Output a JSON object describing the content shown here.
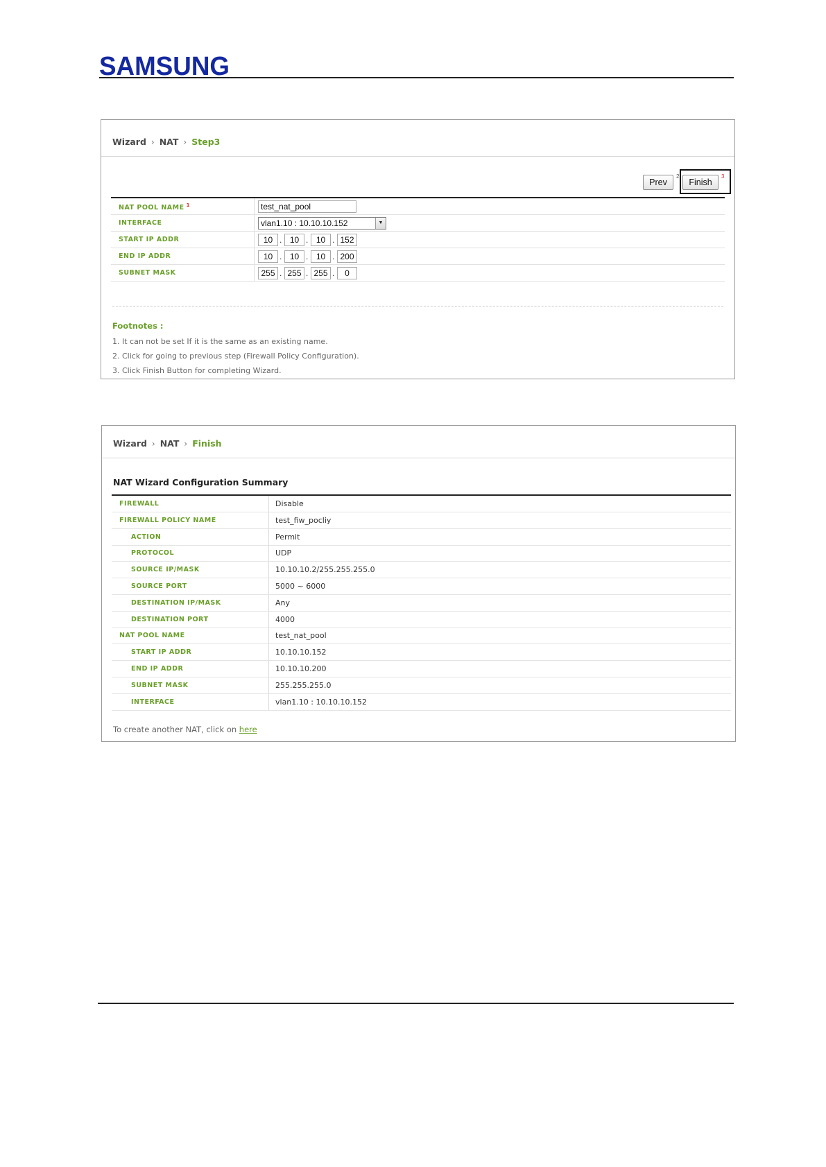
{
  "brand": {
    "logo_text": "SAMSUNG",
    "color": "#1428a0"
  },
  "step3": {
    "breadcrumb": {
      "root": "Wizard",
      "section": "NAT",
      "current": "Step3"
    },
    "buttons": {
      "prev": "Prev",
      "finish": "Finish",
      "prev_note": "2",
      "finish_note": "3"
    },
    "rows": [
      {
        "label": "NAT POOL NAME",
        "note": "1",
        "value": "test_nat_pool"
      },
      {
        "label": "INTERFACE",
        "value": "vlan1.10 : 10.10.10.152"
      },
      {
        "label": "START IP ADDR",
        "octets": [
          "10",
          "10",
          "10",
          "152"
        ]
      },
      {
        "label": "END IP ADDR",
        "octets": [
          "10",
          "10",
          "10",
          "200"
        ]
      },
      {
        "label": "SUBNET MASK",
        "octets": [
          "255",
          "255",
          "255",
          "0"
        ]
      }
    ],
    "footnotes": {
      "title": "Footnotes :",
      "lines": [
        "1. It can not be set If it is the same as an existing name.",
        "2. Click for going to previous step (Firewall Policy Configuration).",
        "3. Click Finish Button for completing Wizard."
      ]
    }
  },
  "finish": {
    "breadcrumb": {
      "root": "Wizard",
      "section": "NAT",
      "current": "Finish"
    },
    "title": "NAT Wizard Configuration Summary",
    "rows": [
      {
        "label": "FIREWALL",
        "value": "Disable",
        "indent": false
      },
      {
        "label": "FIREWALL POLICY NAME",
        "value": "test_fiw_pocliy",
        "indent": false
      },
      {
        "label": "ACTION",
        "value": "Permit",
        "indent": true
      },
      {
        "label": "PROTOCOL",
        "value": "UDP",
        "indent": true
      },
      {
        "label": "SOURCE IP/MASK",
        "value": "10.10.10.2/255.255.255.0",
        "indent": true
      },
      {
        "label": "SOURCE PORT",
        "value": "5000 ~ 6000",
        "indent": true
      },
      {
        "label": "DESTINATION IP/MASK",
        "value": "Any",
        "indent": true
      },
      {
        "label": "DESTINATION PORT",
        "value": "4000",
        "indent": true
      },
      {
        "label": "NAT POOL NAME",
        "value": "test_nat_pool",
        "indent": false
      },
      {
        "label": "START IP ADDR",
        "value": "10.10.10.152",
        "indent": true
      },
      {
        "label": "END IP ADDR",
        "value": "10.10.10.200",
        "indent": true
      },
      {
        "label": "SUBNET MASK",
        "value": "255.255.255.0",
        "indent": true
      },
      {
        "label": "INTERFACE",
        "value": "vlan1.10 : 10.10.10.152",
        "indent": true
      }
    ],
    "another": {
      "text": "To create another NAT, click on ",
      "link": "here"
    }
  },
  "colors": {
    "accent_green": "#6a9f2a",
    "note_red": "#d9312b"
  }
}
